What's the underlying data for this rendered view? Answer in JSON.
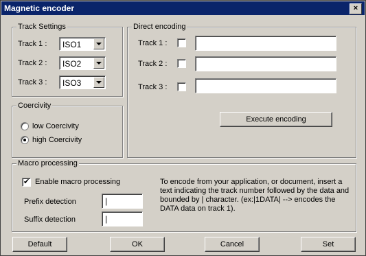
{
  "window": {
    "title": "Magnetic encoder",
    "close_label": "×"
  },
  "track_settings": {
    "legend": "Track Settings",
    "tracks": [
      {
        "label": "Track 1 :",
        "value": "ISO1"
      },
      {
        "label": "Track 2 :",
        "value": "ISO2"
      },
      {
        "label": "Track 3 :",
        "value": "ISO3"
      }
    ]
  },
  "coercivity": {
    "legend": "Coercivity",
    "options": [
      {
        "label": "low Coercivity",
        "selected": false
      },
      {
        "label": "high Coercivity",
        "selected": true
      }
    ]
  },
  "direct_encoding": {
    "legend": "Direct encoding",
    "tracks": [
      {
        "label": "Track 1 :",
        "checked": false,
        "value": ""
      },
      {
        "label": "Track 2 :",
        "checked": false,
        "value": ""
      },
      {
        "label": "Track 3 :",
        "checked": false,
        "value": ""
      }
    ],
    "execute_label": "Execute encoding"
  },
  "macro": {
    "legend": "Macro processing",
    "enable_label": "Enable macro processing",
    "enable_checked": true,
    "prefix_label": "Prefix detection",
    "prefix_value": "|",
    "suffix_label": "Suffix detection",
    "suffix_value": "|",
    "info_text": "To encode from your application, or document, insert a text indicating the track number followed by the data and bounded by | character. (ex:|1DATA| --> encodes the DATA data on track 1)."
  },
  "buttons": {
    "default": "Default",
    "ok": "OK",
    "cancel": "Cancel",
    "set": "Set"
  }
}
